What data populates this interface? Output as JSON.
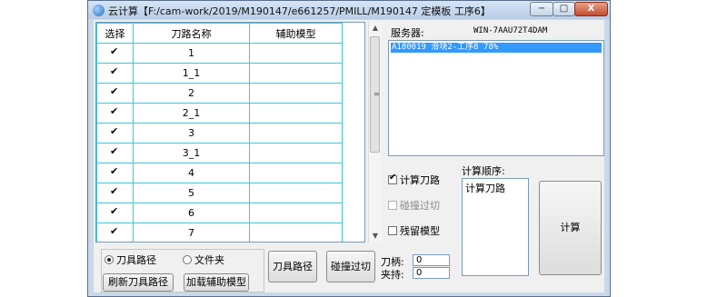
{
  "window": {
    "title": "云计算【F:/cam-work/2019/M190147/e661257/PMILL/M190147 定模板 工序6】",
    "controls": [
      "−",
      "□",
      "X"
    ]
  },
  "table": {
    "headers": [
      "选择",
      "刀路名称",
      "辅助模型"
    ],
    "rows": [
      {
        "name": "1",
        "aux": ""
      },
      {
        "name": "1_1",
        "aux": ""
      },
      {
        "name": "2",
        "aux": ""
      },
      {
        "name": "2_1",
        "aux": ""
      },
      {
        "name": "3",
        "aux": ""
      },
      {
        "name": "3_1",
        "aux": ""
      },
      {
        "name": "4",
        "aux": ""
      },
      {
        "name": "5",
        "aux": ""
      },
      {
        "name": "6",
        "aux": ""
      },
      {
        "name": "7",
        "aux": ""
      }
    ]
  },
  "server": {
    "label": "服务器:",
    "name": "WIN-7AAU72T4DAM",
    "items": [
      "A180019 滑块2-工序8  78%"
    ]
  },
  "options": {
    "calc_toolpath": "计算刀路",
    "collision_cut": "碰撞过切",
    "residual_model": "残留模型"
  },
  "order": {
    "label": "计算顺序:",
    "items": [
      "计算刀路"
    ]
  },
  "buttons": {
    "calc": "计算",
    "tool_path": "刀具路径",
    "collision_cut": "碰撞过切",
    "refresh_paths": "刷新刀具路径",
    "load_aux_model": "加载辅助模型"
  },
  "radios": {
    "tool_path": "刀具路径",
    "folder": "文件夹"
  },
  "fields": {
    "holder_label": "刀柄:",
    "holder_value": "0",
    "chuck_label": "夹持:",
    "chuck_value": "0"
  }
}
